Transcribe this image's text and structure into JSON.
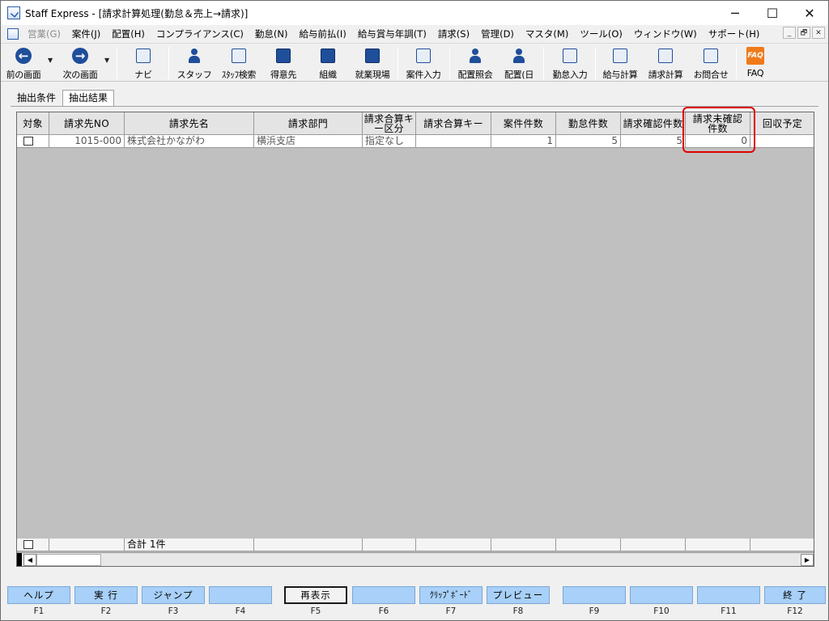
{
  "window": {
    "title": "Staff Express - [請求計算処理(勤怠＆売上→請求)]"
  },
  "controls": {
    "minimize": "─",
    "maximize": "☐",
    "close": "✕",
    "mdi_min": "_",
    "mdi_restore": "🗗",
    "mdi_close": "✕"
  },
  "menu": {
    "items": [
      {
        "label": "営業(G)",
        "disabled": true
      },
      {
        "label": "案件(J)"
      },
      {
        "label": "配置(H)"
      },
      {
        "label": "コンプライアンス(C)"
      },
      {
        "label": "勤怠(N)"
      },
      {
        "label": "給与前払(I)"
      },
      {
        "label": "給与賞与年調(T)"
      },
      {
        "label": "請求(S)"
      },
      {
        "label": "管理(D)"
      },
      {
        "label": "マスタ(M)"
      },
      {
        "label": "ツール(O)"
      },
      {
        "label": "ウィンドウ(W)"
      },
      {
        "label": "サポート(H)"
      }
    ]
  },
  "toolbar": {
    "prev": "前の画面",
    "next": "次の画面",
    "navi": "ナビ",
    "staff": "スタッフ",
    "staff_search": "ｽﾀｯﾌ検索",
    "client": "得意先",
    "org": "組織",
    "worksite": "就業現場",
    "case_entry": "案件入力",
    "placement_inquiry": "配置照会",
    "placement_day": "配置(日",
    "attendance_entry": "勤怠入力",
    "payroll_calc": "給与計算",
    "billing_calc": "請求計算",
    "inquiry": "お問合せ",
    "faq": "FAQ",
    "faq_icon": "FAQ",
    "dropdown_icon": "▼",
    "arrow_left": "←",
    "arrow_right": "→"
  },
  "tabs": {
    "conditions": "抽出条件",
    "results": "抽出結果"
  },
  "grid": {
    "headers": {
      "target": "対象",
      "client_no": "請求先NO",
      "client_name": "請求先名",
      "department": "請求部門",
      "merge_type": "請求合算キー区分",
      "merge_key": "請求合算キー",
      "case_count": "案件件数",
      "attendance_count": "勤怠件数",
      "confirmed_count": "請求確認件数",
      "unconfirmed_count": "請求未確認件数",
      "collection": "回収予定"
    },
    "row": {
      "client_no": "1015-000",
      "client_name": "株式会社かながわ",
      "department": "横浜支店",
      "merge_type": "指定なし",
      "merge_key": "",
      "case_count": "1",
      "attendance_count": "5",
      "confirmed_count": "5",
      "unconfirmed_count": "0",
      "collection": ""
    },
    "summary": "合計 1件",
    "scroll_left": "◀",
    "scroll_right": "▶"
  },
  "fkeys": [
    {
      "label": "ヘルプ",
      "key": "F1"
    },
    {
      "label": "実 行",
      "key": "F2"
    },
    {
      "label": "ジャンプ",
      "key": "F3"
    },
    {
      "label": "",
      "key": "F4"
    },
    {
      "label": "再表示",
      "key": "F5"
    },
    {
      "label": "",
      "key": "F6"
    },
    {
      "label": "ｸﾘｯﾌﾟﾎﾞｰﾄﾞ",
      "key": "F7"
    },
    {
      "label": "プレビュー",
      "key": "F8"
    },
    {
      "label": "",
      "key": "F9"
    },
    {
      "label": "",
      "key": "F10"
    },
    {
      "label": "",
      "key": "F11"
    },
    {
      "label": "終 了",
      "key": "F12"
    }
  ]
}
